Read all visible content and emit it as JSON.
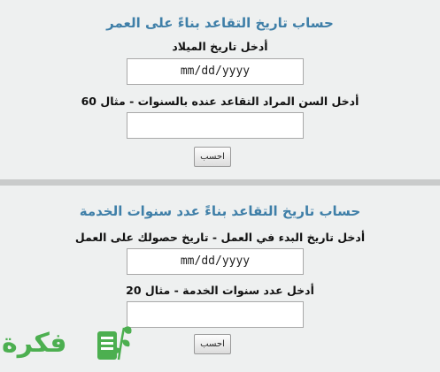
{
  "age_calculator": {
    "title": "حساب تاريخ التقاعد بناءً على العمر",
    "birth_label": "أدخل تاريخ الميلاد",
    "birth_placeholder": "mm/dd/yyyy",
    "age_label": "أدخل السن المراد التقاعد عنده بالسنوات - مثال 60",
    "age_value": "",
    "button_label": "احسب"
  },
  "service_calculator": {
    "title": "حساب تاريخ التقاعد بناءً عدد سنوات الخدمة",
    "start_label": "أدخل تاريخ البدء في العمل - تاريخ حصولك على العمل",
    "start_placeholder": "mm/dd/yyyy",
    "years_label": "أدخل عدد سنوات الخدمة - مثال 20",
    "years_value": "",
    "button_label": "احسب"
  },
  "watermark": {
    "text": "فكرة",
    "icon": "book-with-leaves-icon",
    "color": "#4caf50"
  }
}
